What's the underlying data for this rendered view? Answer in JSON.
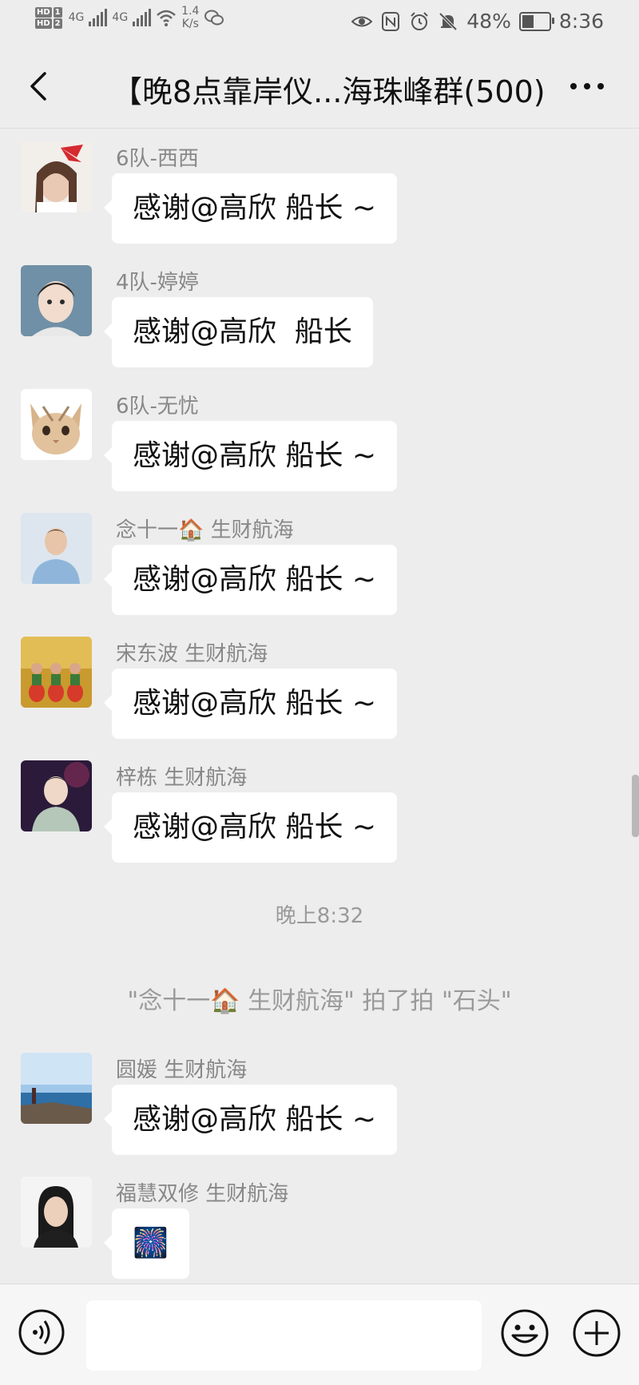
{
  "status_bar": {
    "hd1": "HD",
    "hd1_num": "1",
    "hd2": "HD",
    "hd2_num": "2",
    "net1": "4G",
    "net2": "4G",
    "speed_value": "1.4",
    "speed_unit": "K/s",
    "battery_percent": "48%",
    "battery_level": 0.48,
    "time": "8:36"
  },
  "header": {
    "title": "【晚8点靠岸仪...海珠峰群(500)"
  },
  "messages": [
    {
      "sender": "6队-西西",
      "text": "感谢@高欣 船长 ~"
    },
    {
      "sender": "4队-婷婷",
      "text": "感谢@高欣  船长"
    },
    {
      "sender": "6队-无忧",
      "text": "感谢@高欣 船长 ~"
    },
    {
      "sender": "念十一🏠 生财航海",
      "text": "感谢@高欣 船长 ~"
    },
    {
      "sender": "宋东波 生财航海",
      "text": "感谢@高欣 船长 ~"
    },
    {
      "sender": "梓栋 生财航海",
      "text": "感谢@高欣 船长 ~"
    },
    {
      "sender": "圆媛 生财航海",
      "text": "感谢@高欣 船长 ~"
    },
    {
      "sender": "福慧双修 生财航海",
      "text": "🎆"
    }
  ],
  "timestamp": "晚上8:32",
  "system_note": "\"念十一🏠 生财航海\" 拍了拍 \"石头\"",
  "input": {
    "value": "",
    "placeholder": ""
  },
  "icons": {
    "back": "back-arrow-icon",
    "more": "more-dots-icon",
    "voice": "voice-icon",
    "emoji": "emoji-icon",
    "plus": "plus-icon"
  },
  "colors": {
    "background": "#ededed",
    "bubble": "#ffffff",
    "sender_text": "#888888",
    "system_text": "#9a9a9a"
  }
}
